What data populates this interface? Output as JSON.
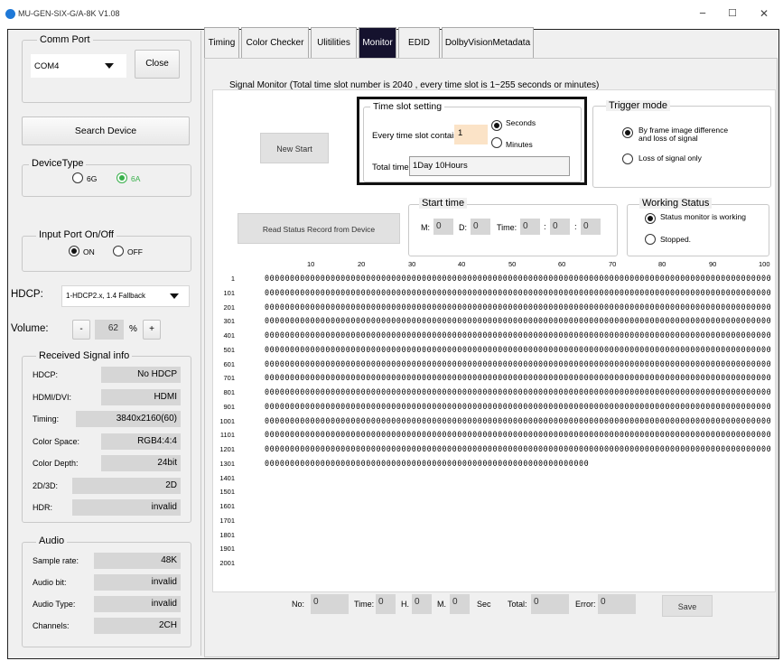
{
  "app": {
    "title": "MU-GEN-SIX-G/A-8K V1.08",
    "min": "−",
    "max": "☐",
    "close": "✕"
  },
  "comm": {
    "label": "Comm Port",
    "port": "COM4",
    "close_btn": "Close"
  },
  "search_btn": "Search Device",
  "device_type": {
    "label": "DeviceType",
    "opt_6g": "6G",
    "opt_6a": "6A",
    "selected": "6A"
  },
  "input_port": {
    "label": "Input Port On/Off",
    "on": "ON",
    "off": "OFF",
    "selected": "ON"
  },
  "hdcp": {
    "label": "HDCP:",
    "value": "1-HDCP2.x, 1.4 Fallback"
  },
  "volume": {
    "label": "Volume:",
    "minus": "-",
    "value": "62",
    "unit": "%",
    "plus": "+"
  },
  "received": {
    "label": "Received Signal info",
    "rows": [
      {
        "key": "HDCP:",
        "val": "No HDCP"
      },
      {
        "key": "HDMI/DVI:",
        "val": "HDMI"
      },
      {
        "key": "Timing:",
        "val": "3840x2160(60)"
      },
      {
        "key": "Color Space:",
        "val": "RGB4:4:4"
      },
      {
        "key": "Color Depth:",
        "val": "24bit"
      },
      {
        "key": "2D/3D:",
        "val": "2D"
      },
      {
        "key": "HDR:",
        "val": "invalid"
      }
    ]
  },
  "audio": {
    "label": "Audio",
    "rows": [
      {
        "key": "Sample rate:",
        "val": "48K"
      },
      {
        "key": "Audio bit:",
        "val": "invalid"
      },
      {
        "key": "Audio Type:",
        "val": "invalid"
      },
      {
        "key": "Channels:",
        "val": "2CH"
      }
    ]
  },
  "tabs": [
    "Timing",
    "Color Checker",
    "Ulitilities",
    "Monitor",
    "EDID",
    "DolbyVisionMetadata"
  ],
  "active_tab": "Monitor",
  "monitor": {
    "heading": "Signal Monitor (Total time slot number is 2040 , every time slot is 1~255 seconds or minutes)",
    "new_start": "New Start",
    "read_status": "Read Status Record from Device",
    "timeslot": {
      "label": "Time slot setting",
      "contain_label": "Every time slot contain:",
      "contain_value": "1",
      "seconds": "Seconds",
      "minutes": "Minutes",
      "selected": "Seconds",
      "total_label": "Total time:",
      "total_value": "1Day 10Hours"
    },
    "trigger": {
      "label": "Trigger mode",
      "opt1": "By frame image difference\nand loss of signal",
      "opt2": "Loss of signal only",
      "selected": 1
    },
    "start_time": {
      "label": "Start time",
      "m_label": "M:",
      "m": "0",
      "d_label": "D:",
      "d": "0",
      "time_label": "Time:",
      "h": "0",
      "sep1": ":",
      "min": "0",
      "sep2": ":",
      "s": "0"
    },
    "working": {
      "label": "Working Status",
      "opt1": "Status monitor is working",
      "opt2": "Stopped.",
      "selected": 1
    },
    "col_headers": [
      "10",
      "20",
      "30",
      "40",
      "50",
      "60",
      "70",
      "80",
      "90",
      "100"
    ],
    "rows": [
      {
        "n": "1",
        "d": "0000000000000000000000000000000000000000000000000000000000000000000000000000000000000000000000000000"
      },
      {
        "n": "101",
        "d": "0000000000000000000000000000000000000000000000000000000000000000000000000000000000000000000000000000"
      },
      {
        "n": "201",
        "d": "0000000000000000000000000000000000000000000000000000000000000000000000000000000000000000000000000000"
      },
      {
        "n": "301",
        "d": "0000000000000000000000000000000000000000000000000000000000000000000000000000000000000000000000000000"
      },
      {
        "n": "401",
        "d": "0000000000000000000000000000000000000000000000000000000000000000000000000000000000000000000000000000"
      },
      {
        "n": "501",
        "d": "0000000000000000000000000000000000000000000000000000000000000000000000000000000000000000000000000000"
      },
      {
        "n": "601",
        "d": "0000000000000000000000000000000000000000000000000000000000000000000000000000000000000000000000000000"
      },
      {
        "n": "701",
        "d": "0000000000000000000000000000000000000000000000000000000000000000000000000000000000000000000000000000"
      },
      {
        "n": "801",
        "d": "0000000000000000000000000000000000000000000000000000000000000000000000000000000000000000000000000000"
      },
      {
        "n": "901",
        "d": "0000000000000000000000000000000000000000000000000000000000000000000000000000000000000000000000000000"
      },
      {
        "n": "1001",
        "d": "0000000000000000000000000000000000000000000000000000000000000000000000000000000000000000000000000000"
      },
      {
        "n": "1101",
        "d": "0000000000000000000000000000000000000000000000000000000000000000000000000000000000000000000000000000"
      },
      {
        "n": "1201",
        "d": "0000000000000000000000000000000000000000000000000000000000000000000000000000000000000000000000000000"
      },
      {
        "n": "1301",
        "d": "0000000000000000000000000000000000000000000000000000000000000000"
      },
      {
        "n": "1401",
        "d": ""
      },
      {
        "n": "1501",
        "d": ""
      },
      {
        "n": "1601",
        "d": ""
      },
      {
        "n": "1701",
        "d": ""
      },
      {
        "n": "1801",
        "d": ""
      },
      {
        "n": "1901",
        "d": ""
      },
      {
        "n": "2001",
        "d": ""
      }
    ],
    "footer": {
      "no_label": "No:",
      "no": "0",
      "time_label": "Time:",
      "h": "0",
      "h_label": "H.",
      "m": "0",
      "m_label": "M.",
      "s": "0",
      "sec_label": "Sec",
      "total_label": "Total:",
      "total": "0",
      "error_label": "Error:",
      "error": "0",
      "save": "Save"
    }
  }
}
